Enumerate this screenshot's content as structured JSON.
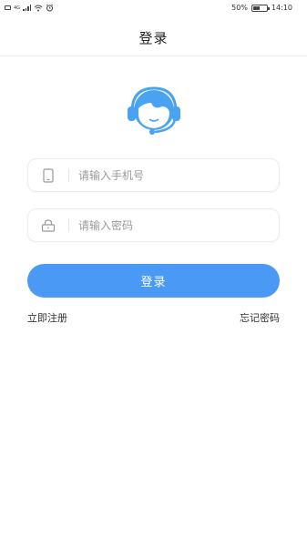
{
  "status_bar": {
    "network_label": "4G",
    "battery_text": "50%",
    "battery_level": 0.5,
    "time": "14:10"
  },
  "header": {
    "title": "登录"
  },
  "form": {
    "phone_placeholder": "请输入手机号",
    "password_placeholder": "请输入密码",
    "login_label": "登录"
  },
  "links": {
    "register": "立即注册",
    "forgot_password": "忘记密码"
  },
  "colors": {
    "accent": "#4a9af5",
    "avatar_blue": "#4aa3f2"
  },
  "icons": {
    "avatar": "customer-service-headset-icon",
    "phone": "phone-icon",
    "lock": "lock-icon"
  }
}
